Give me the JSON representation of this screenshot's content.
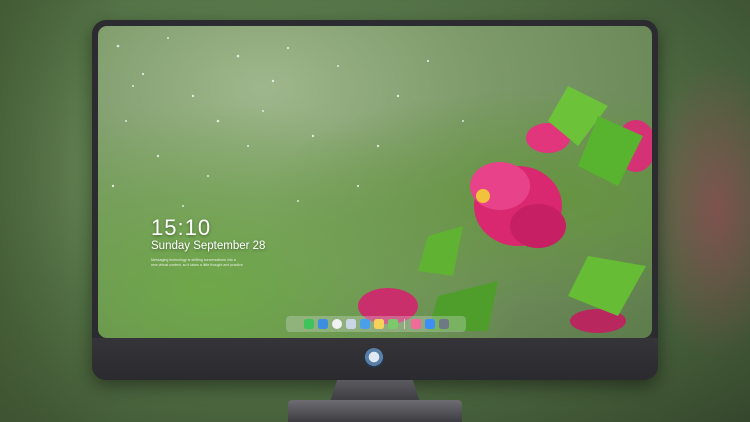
{
  "lock_screen": {
    "time": "15:10",
    "date": "Sunday September 28",
    "notice_line_1": "Messaging technology is shifting conversations into a",
    "notice_line_2": "new virtual context, so it takes a little thought and practice"
  },
  "dock": {
    "apps": [
      {
        "name": "messages-icon",
        "color": "#3dc45a"
      },
      {
        "name": "finder-icon",
        "color": "#3b8fe0"
      },
      {
        "name": "clock-icon",
        "color": "#f2f2f2"
      },
      {
        "name": "preview-icon",
        "color": "#c9d6e4"
      },
      {
        "name": "clapper-icon",
        "color": "#4aa0e8"
      },
      {
        "name": "notes-icon",
        "color": "#f6d25a"
      },
      {
        "name": "photos-icon",
        "color": "#7cc86a"
      },
      {
        "name": "music-icon",
        "color": "#f06a9a"
      },
      {
        "name": "app-store-icon",
        "color": "#3e8ff5"
      },
      {
        "name": "camera-icon",
        "color": "#6f7885"
      }
    ]
  },
  "colors": {
    "bezel": "#2b2b30",
    "flower": "#d9286f",
    "leaf": "#6cc33a"
  }
}
